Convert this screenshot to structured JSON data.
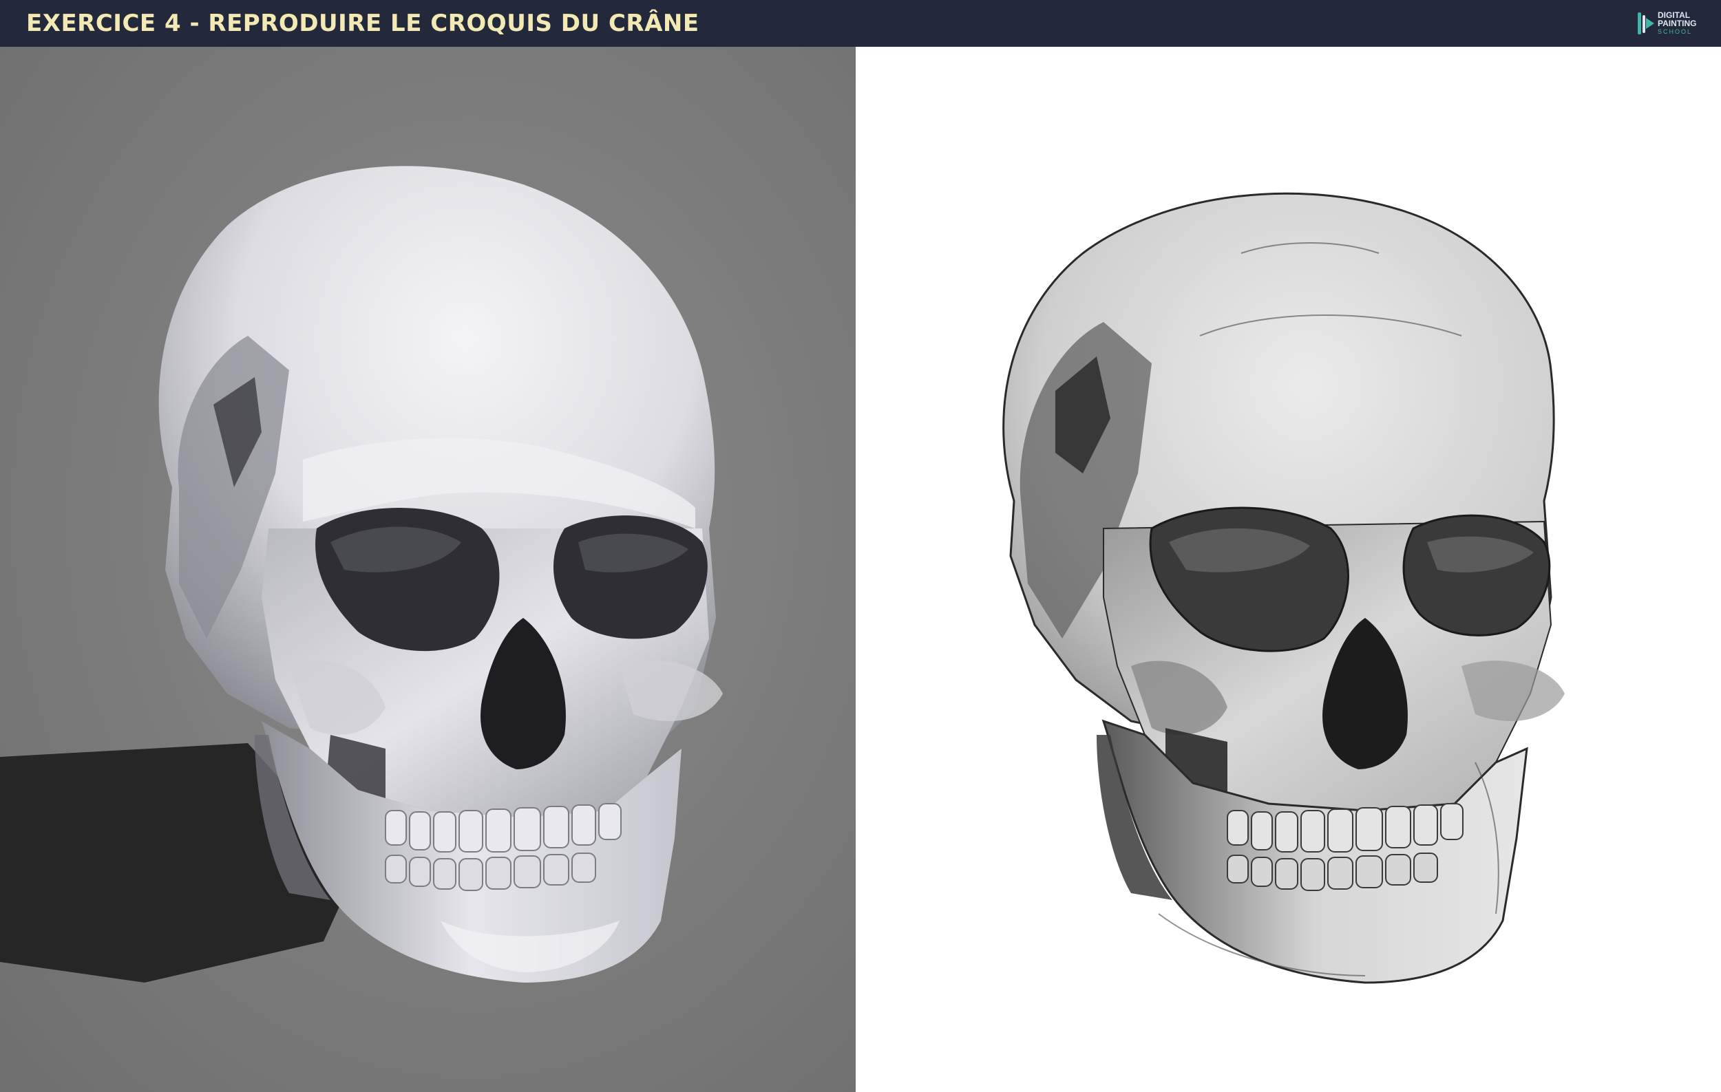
{
  "header": {
    "title": "EXERCICE 4 - REPRODUIRE LE CROQUIS DU CRÂNE",
    "logo": {
      "lines": [
        "DIGITAL",
        "PAINTING",
        "SCHOOL"
      ],
      "icon": "paintbrush-play-icon"
    }
  },
  "panels": {
    "left": {
      "content": "3d-skull-render",
      "background": "#7c7c7c"
    },
    "right": {
      "content": "skull-sketch-drawing",
      "background": "#ffffff"
    }
  },
  "colors": {
    "header_bg": "#23293a",
    "title_text": "#f3e9b4",
    "logo_accent": "#3fb6a7"
  }
}
